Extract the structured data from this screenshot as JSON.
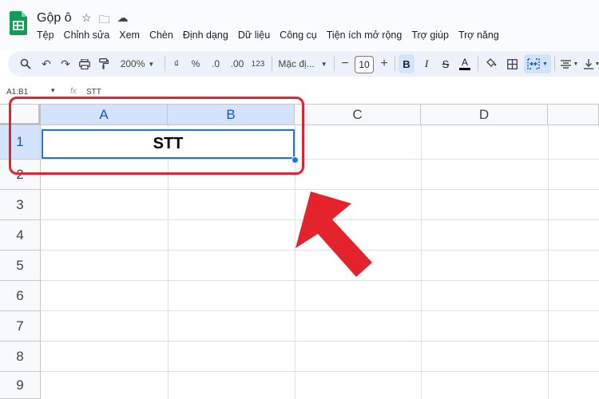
{
  "document": {
    "title": "Gộp ô"
  },
  "menu": [
    "Tệp",
    "Chỉnh sửa",
    "Xem",
    "Chèn",
    "Định dạng",
    "Dữ liệu",
    "Công cụ",
    "Tiện ích mở rộng",
    "Trợ giúp",
    "Trợ năng"
  ],
  "toolbar": {
    "zoom": "200%",
    "currency": "₫",
    "percent": "%",
    "decrease_decimal": ".0",
    "increase_decimal": ".00",
    "number_format": "123",
    "font": "Mặc đị...",
    "minus": "−",
    "font_size": "10",
    "plus": "+",
    "bold": "B",
    "italic": "I",
    "strike": "S",
    "text_color": "A"
  },
  "formula_bar": {
    "name_box": "A1:B1",
    "fx": "fx",
    "content": "STT"
  },
  "columns": [
    "A",
    "B",
    "C",
    "D"
  ],
  "rows": [
    "1",
    "2",
    "3",
    "4",
    "5",
    "6",
    "7",
    "8",
    "9"
  ],
  "cells": {
    "A1_B1_merged": "STT"
  },
  "colors": {
    "selection_blue": "#1a73e8",
    "annotation_red": "#e3222c",
    "header_selected": "#d3e3fd"
  }
}
